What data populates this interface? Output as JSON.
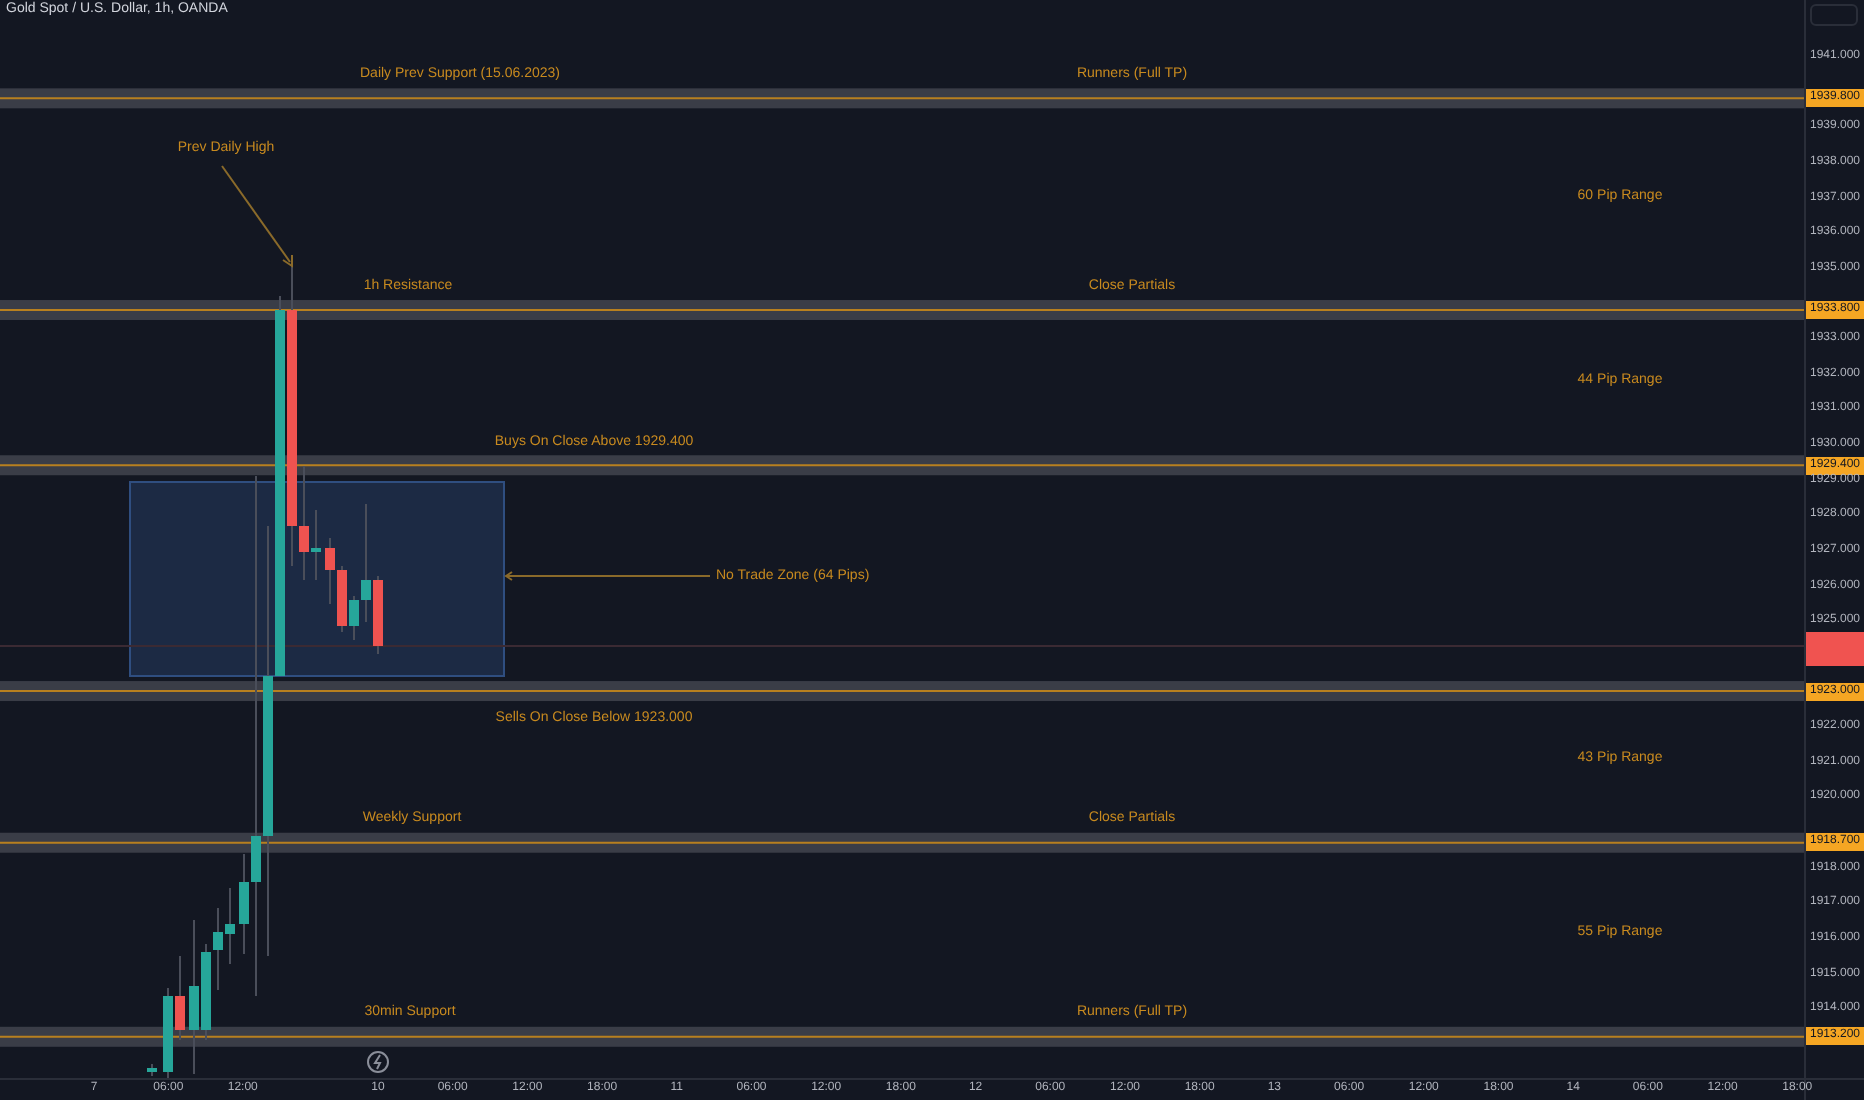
{
  "symbol_title": "Gold Spot / U.S. Dollar, 1h, OANDA",
  "levels": [
    {
      "price": "1939.800",
      "labels": [
        "Daily Prev Support (15.06.2023)",
        "Runners (Full TP)"
      ]
    },
    {
      "price": "1933.800",
      "labels": [
        "1h Resistance",
        "Close Partials"
      ]
    },
    {
      "price": "1929.400",
      "labels": [
        "Buys On Close Above 1929.400"
      ]
    },
    {
      "price": "1923.000",
      "labels": [
        "Sells On Close Below 1923.000"
      ]
    },
    {
      "price": "1918.700",
      "labels": [
        "Weekly Support",
        "Close Partials"
      ]
    },
    {
      "price": "1913.200",
      "labels": [
        "30min Support",
        "Runners (Full TP)"
      ]
    }
  ],
  "ranges": [
    "60 Pip Range",
    "44 Pip Range",
    "43 Pip Range",
    "55 Pip Range"
  ],
  "prev_high_note": "Prev Daily High",
  "no_trade_zone": "No Trade Zone (64 Pips)",
  "price_ticks": [
    "1941.000",
    "1939.000",
    "1938.000",
    "1937.000",
    "1936.000",
    "1935.000",
    "1933.000",
    "1932.000",
    "1931.000",
    "1930.000",
    "1929.000",
    "1928.000",
    "1927.000",
    "1926.000",
    "1925.000",
    "1922.000",
    "1921.000",
    "1920.000",
    "1918.000",
    "1917.000",
    "1916.000",
    "1915.000",
    "1914.000"
  ],
  "time_ticks": [
    "7",
    "06:00",
    "12:00",
    "10",
    "06:00",
    "12:00",
    "18:00",
    "11",
    "06:00",
    "12:00",
    "18:00",
    "12",
    "06:00",
    "12:00",
    "18:00",
    "13",
    "06:00",
    "12:00",
    "18:00",
    "14",
    "06:00",
    "12:00",
    "18:00"
  ]
}
